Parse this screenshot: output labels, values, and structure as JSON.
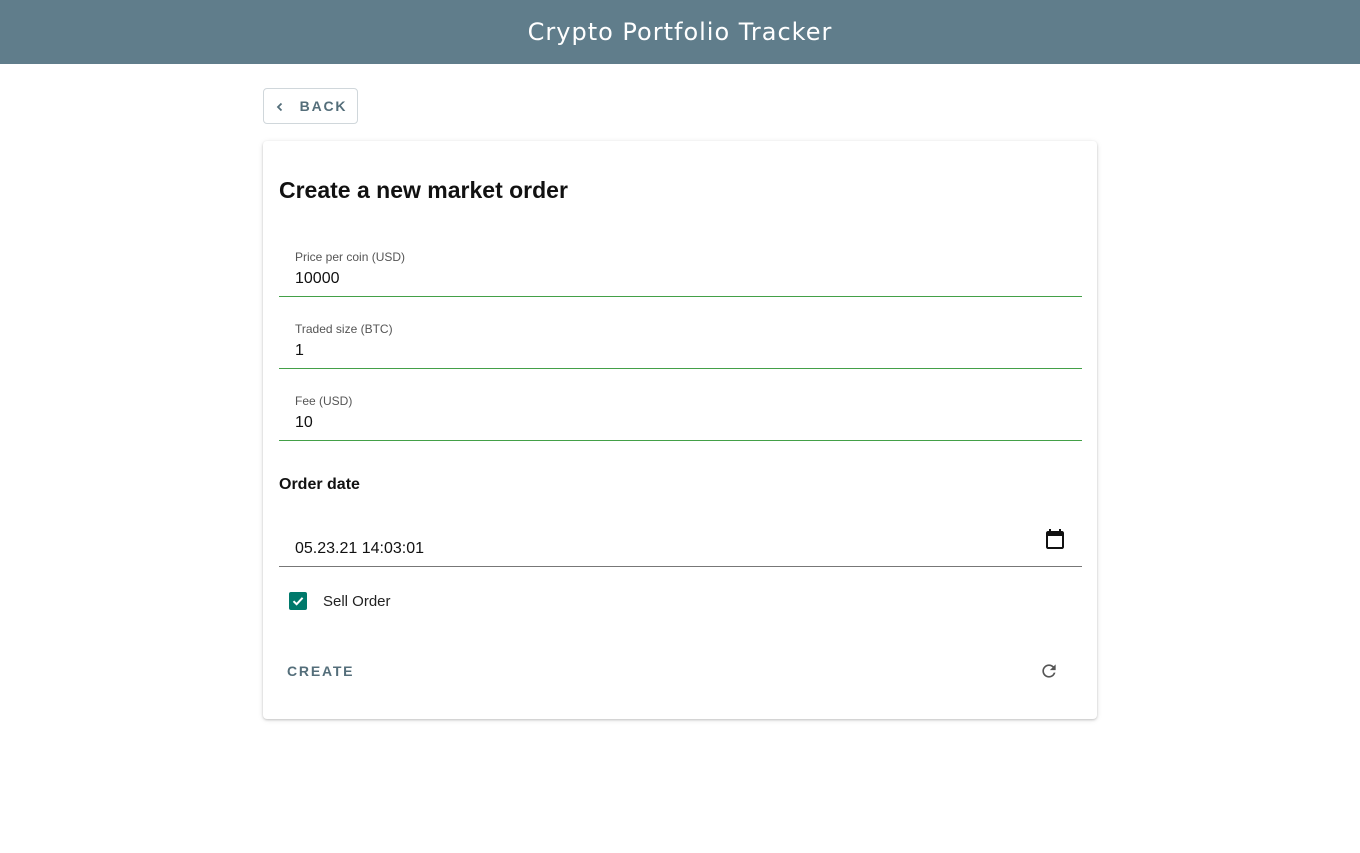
{
  "app": {
    "title": "Crypto Portfolio Tracker"
  },
  "nav": {
    "back_label": "BACK",
    "back_icon": "chevron-left-icon"
  },
  "form": {
    "title": "Create a new market order",
    "fields": [
      {
        "label": "Price per coin (USD)",
        "value": "10000"
      },
      {
        "label": "Traded size (BTC)",
        "value": "1"
      },
      {
        "label": "Fee (USD)",
        "value": "10"
      }
    ],
    "order_date": {
      "section_title": "Order date",
      "value": "05.23.21 14:03:01",
      "icon": "calendar-icon"
    },
    "sell_order": {
      "label": "Sell Order",
      "checked": true
    },
    "actions": {
      "create_label": "CREATE",
      "reset_icon": "refresh-icon"
    }
  },
  "colors": {
    "app_bar": "#607d8b",
    "field_underline": "#43a047",
    "checkbox": "#00796b",
    "button_text": "#546e7a"
  }
}
